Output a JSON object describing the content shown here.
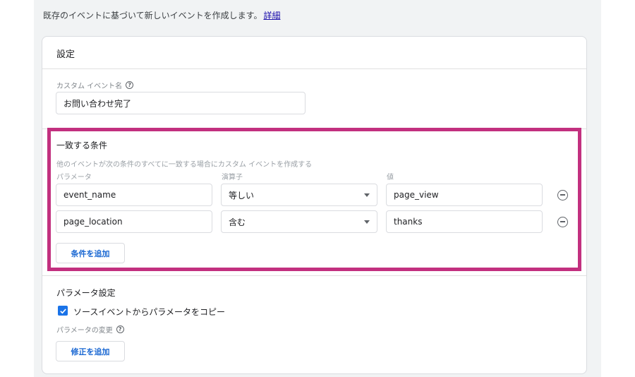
{
  "intro": {
    "text": "既存のイベントに基づいて新しいイベントを作成します。",
    "link": "詳細"
  },
  "settings": {
    "title": "設定",
    "custom_event_name": {
      "label": "カスタム イベント名",
      "value": "お問い合わせ完了"
    }
  },
  "conditions": {
    "title": "一致する条件",
    "description": "他のイベントが次の条件のすべてに一致する場合にカスタム イベントを作成する",
    "headers": {
      "parameter": "パラメータ",
      "operator": "演算子",
      "value": "値"
    },
    "rows": [
      {
        "parameter": "event_name",
        "operator": "等しい",
        "value": "page_view"
      },
      {
        "parameter": "page_location",
        "operator": "含む",
        "value": "thanks"
      }
    ],
    "add_label": "条件を追加"
  },
  "params": {
    "title": "パラメータ設定",
    "copy_checkbox": {
      "label": "ソースイベントからパラメータをコピー",
      "checked": true
    },
    "modify_label": "パラメータの変更",
    "add_modification_label": "修正を追加"
  },
  "colors": {
    "accent": "#1a73e8",
    "highlight": "#c2307f"
  }
}
